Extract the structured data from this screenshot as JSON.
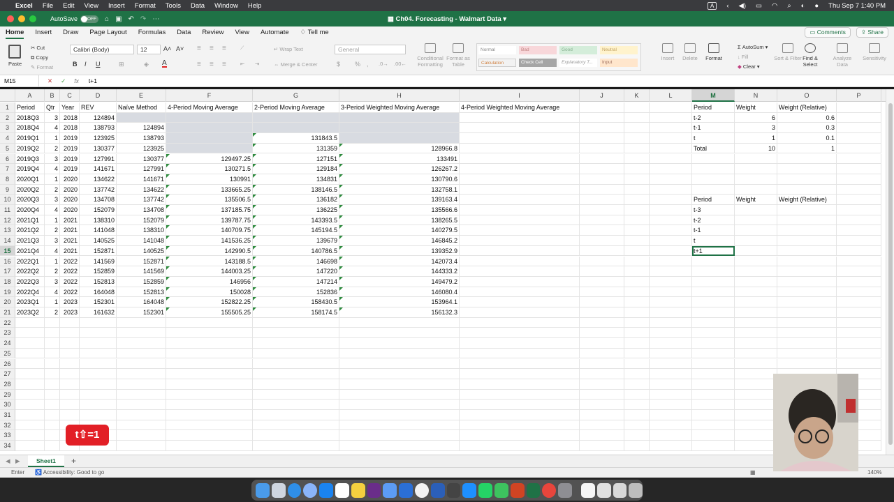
{
  "menubar": {
    "items": [
      "Excel",
      "File",
      "Edit",
      "View",
      "Insert",
      "Format",
      "Tools",
      "Data",
      "Window",
      "Help"
    ],
    "input_badge": "A",
    "datetime": "Thu Sep 7  1:40 PM"
  },
  "titlebar": {
    "autosave_label": "AutoSave",
    "autosave_state": "OFF",
    "document_title": "Ch04. Forecasting - Walmart Data"
  },
  "ribbon_tabs": [
    "Home",
    "Insert",
    "Draw",
    "Page Layout",
    "Formulas",
    "Data",
    "Review",
    "View",
    "Automate"
  ],
  "tell_me": "Tell me",
  "comments_label": "Comments",
  "share_label": "Share",
  "ribbon": {
    "paste": "Paste",
    "cut": "Cut",
    "copy": "Copy",
    "format": "Format",
    "font_name": "Calibri (Body)",
    "font_size": "12",
    "wrap_text": "Wrap Text",
    "merge_center": "Merge & Center",
    "number_format": "General",
    "conditional_formatting": "Conditional Formatting",
    "format_as_table": "Format as Table",
    "styles": [
      "Normal",
      "Bad",
      "Good",
      "Neutral",
      "Calculation",
      "Check Cell",
      "Explanatory T...",
      "Input"
    ],
    "insert": "Insert",
    "delete": "Delete",
    "format_cells": "Format",
    "autosum": "AutoSum",
    "fill": "Fill",
    "clear": "Clear",
    "sort_filter": "Sort & Filter",
    "find_select": "Find & Select",
    "analyze_data": "Analyze Data",
    "sensitivity": "Sensitivity"
  },
  "formula_bar": {
    "name_box": "M15",
    "content": "t+1"
  },
  "columns": [
    "A",
    "B",
    "C",
    "D",
    "E",
    "F",
    "G",
    "H",
    "I",
    "J",
    "K",
    "L",
    "M",
    "N",
    "O",
    "P"
  ],
  "selected_column": "M",
  "headers": {
    "A": "Period",
    "B": "Qtr",
    "C": "Year",
    "D": "REV",
    "E": "Naïve Method",
    "F": "4-Period Moving Average",
    "G": "2-Period Moving Average",
    "H": "3-Period Weighted Moving Average",
    "I": "4-Period Weighted Moving Average"
  },
  "data_rows": [
    {
      "A": "2018Q3",
      "B": "3",
      "C": "2018",
      "D": "124894",
      "E": "",
      "F": "",
      "G": "",
      "H": ""
    },
    {
      "A": "2018Q4",
      "B": "4",
      "C": "2018",
      "D": "138793",
      "E": "124894",
      "F": "",
      "G": "",
      "H": ""
    },
    {
      "A": "2019Q1",
      "B": "1",
      "C": "2019",
      "D": "123925",
      "E": "138793",
      "F": "",
      "G": "131843.5",
      "H": ""
    },
    {
      "A": "2019Q2",
      "B": "2",
      "C": "2019",
      "D": "130377",
      "E": "123925",
      "F": "",
      "G": "131359",
      "H": "128966.8"
    },
    {
      "A": "2019Q3",
      "B": "3",
      "C": "2019",
      "D": "127991",
      "E": "130377",
      "F": "129497.25",
      "G": "127151",
      "H": "133491"
    },
    {
      "A": "2019Q4",
      "B": "4",
      "C": "2019",
      "D": "141671",
      "E": "127991",
      "F": "130271.5",
      "G": "129184",
      "H": "126267.2"
    },
    {
      "A": "2020Q1",
      "B": "1",
      "C": "2020",
      "D": "134622",
      "E": "141671",
      "F": "130991",
      "G": "134831",
      "H": "130790.6"
    },
    {
      "A": "2020Q2",
      "B": "2",
      "C": "2020",
      "D": "137742",
      "E": "134622",
      "F": "133665.25",
      "G": "138146.5",
      "H": "132758.1"
    },
    {
      "A": "2020Q3",
      "B": "3",
      "C": "2020",
      "D": "134708",
      "E": "137742",
      "F": "135506.5",
      "G": "136182",
      "H": "139163.4"
    },
    {
      "A": "2020Q4",
      "B": "4",
      "C": "2020",
      "D": "152079",
      "E": "134708",
      "F": "137185.75",
      "G": "136225",
      "H": "135566.6"
    },
    {
      "A": "2021Q1",
      "B": "1",
      "C": "2021",
      "D": "138310",
      "E": "152079",
      "F": "139787.75",
      "G": "143393.5",
      "H": "138265.5"
    },
    {
      "A": "2021Q2",
      "B": "2",
      "C": "2021",
      "D": "141048",
      "E": "138310",
      "F": "140709.75",
      "G": "145194.5",
      "H": "140279.5"
    },
    {
      "A": "2021Q3",
      "B": "3",
      "C": "2021",
      "D": "140525",
      "E": "141048",
      "F": "141536.25",
      "G": "139679",
      "H": "146845.2"
    },
    {
      "A": "2021Q4",
      "B": "4",
      "C": "2021",
      "D": "152871",
      "E": "140525",
      "F": "142990.5",
      "G": "140786.5",
      "H": "139352.9"
    },
    {
      "A": "2022Q1",
      "B": "1",
      "C": "2022",
      "D": "141569",
      "E": "152871",
      "F": "143188.5",
      "G": "146698",
      "H": "142073.4"
    },
    {
      "A": "2022Q2",
      "B": "2",
      "C": "2022",
      "D": "152859",
      "E": "141569",
      "F": "144003.25",
      "G": "147220",
      "H": "144333.2"
    },
    {
      "A": "2022Q3",
      "B": "3",
      "C": "2022",
      "D": "152813",
      "E": "152859",
      "F": "146956",
      "G": "147214",
      "H": "149479.2"
    },
    {
      "A": "2022Q4",
      "B": "4",
      "C": "2022",
      "D": "164048",
      "E": "152813",
      "F": "150028",
      "G": "152836",
      "H": "146080.4"
    },
    {
      "A": "2023Q1",
      "B": "1",
      "C": "2023",
      "D": "152301",
      "E": "164048",
      "F": "152822.25",
      "G": "158430.5",
      "H": "153964.1"
    },
    {
      "A": "2023Q2",
      "B": "2",
      "C": "2023",
      "D": "161632",
      "E": "152301",
      "F": "155505.25",
      "G": "158174.5",
      "H": "156132.3"
    }
  ],
  "weights_table_1": {
    "headers": [
      "Period",
      "Weight",
      "Weight (Relative)"
    ],
    "rows": [
      [
        "t-2",
        "6",
        "0.6"
      ],
      [
        "t-1",
        "3",
        "0.3"
      ],
      [
        "t",
        "1",
        "0.1"
      ],
      [
        "Total",
        "10",
        "1"
      ]
    ]
  },
  "weights_table_2": {
    "headers": [
      "Period",
      "Weight",
      "Weight (Relative)"
    ],
    "rows": [
      [
        "t-3"
      ],
      [
        "t-2"
      ],
      [
        "t-1"
      ],
      [
        "t"
      ],
      [
        "t+1"
      ]
    ]
  },
  "row_numbers": [
    "1",
    "2",
    "3",
    "4",
    "5",
    "6",
    "7",
    "8",
    "9",
    "10",
    "11",
    "12",
    "13",
    "14",
    "15",
    "16",
    "17",
    "18",
    "19",
    "20",
    "21",
    "22",
    "23",
    "24",
    "25",
    "26",
    "27",
    "28",
    "29",
    "30",
    "31",
    "32",
    "33",
    "34"
  ],
  "selected_row": "15",
  "sheet_tab": "Sheet1",
  "status": {
    "mode": "Enter",
    "accessibility": "Accessibility: Good to go",
    "zoom": "140%"
  },
  "keystroke_overlay": "t⇧=1",
  "colors": {
    "excel_green": "#1f7246",
    "shade": "#d8dbe1",
    "overlay_red": "#e21f26"
  }
}
